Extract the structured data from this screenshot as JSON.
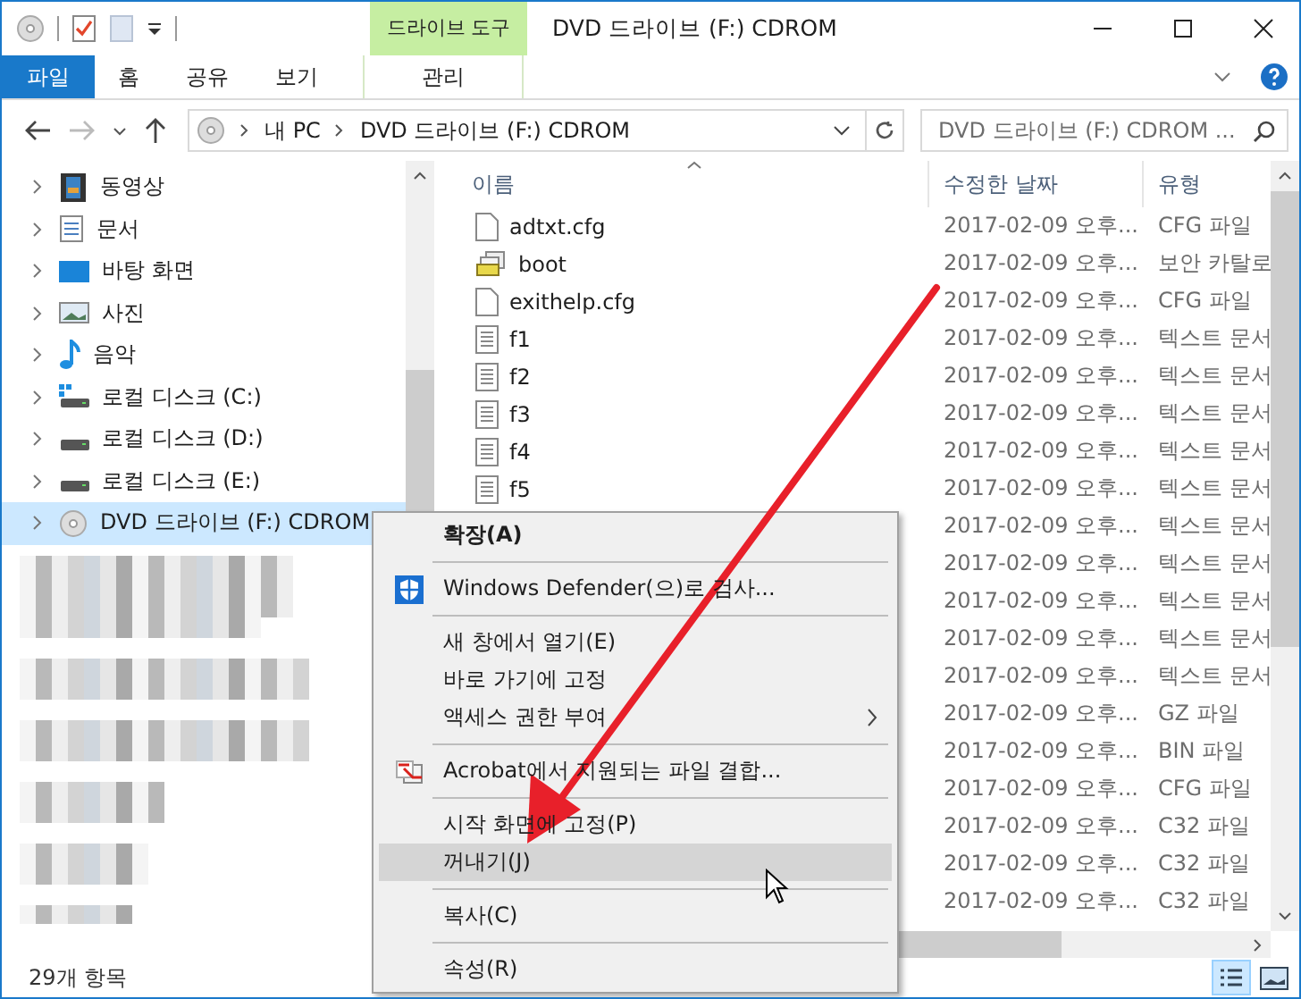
{
  "window": {
    "title": "DVD 드라이브 (F:) CDROM",
    "context_group": "드라이브 도구"
  },
  "ribbon_tabs": [
    {
      "label": "파일",
      "kind": "file",
      "selected": false
    },
    {
      "label": "홈",
      "kind": "tab",
      "selected": false
    },
    {
      "label": "공유",
      "kind": "tab",
      "selected": false
    },
    {
      "label": "보기",
      "kind": "tab",
      "selected": false
    },
    {
      "label": "관리",
      "kind": "contextual",
      "selected": false
    }
  ],
  "address_bar": {
    "path": [
      "내 PC",
      "DVD 드라이브 (F:) CDROM"
    ]
  },
  "search": {
    "placeholder": "DVD 드라이브 (F:) CDROM ..."
  },
  "nav_pane": {
    "items": [
      {
        "label": "동영상",
        "kind": "video",
        "selected": false
      },
      {
        "label": "문서",
        "kind": "document",
        "selected": false
      },
      {
        "label": "바탕 화면",
        "kind": "desktop",
        "selected": false
      },
      {
        "label": "사진",
        "kind": "photo",
        "selected": false
      },
      {
        "label": "음악",
        "kind": "music",
        "selected": false
      },
      {
        "label": "로컬 디스크 (C:)",
        "kind": "system",
        "selected": false
      },
      {
        "label": "로컬 디스크 (D:)",
        "kind": "drive",
        "selected": false
      },
      {
        "label": "로컬 디스크 (E:)",
        "kind": "drive",
        "selected": false
      },
      {
        "label": "DVD 드라이브 (F:) CDROM",
        "kind": "disc",
        "selected": true
      }
    ]
  },
  "file_list": {
    "columns": [
      "이름",
      "수정한 날짜",
      "유형"
    ],
    "rows": [
      {
        "name": "adtxt.cfg",
        "kind": "blank",
        "modified": "2017-02-09 오후...",
        "type": "CFG 파일"
      },
      {
        "name": "boot",
        "kind": "catalog",
        "modified": "2017-02-09 오후...",
        "type": "보안 카탈로"
      },
      {
        "name": "exithelp.cfg",
        "kind": "blank",
        "modified": "2017-02-09 오후...",
        "type": "CFG 파일"
      },
      {
        "name": "f1",
        "kind": "text",
        "modified": "2017-02-09 오후...",
        "type": "텍스트 문서"
      },
      {
        "name": "f2",
        "kind": "text",
        "modified": "2017-02-09 오후...",
        "type": "텍스트 문서"
      },
      {
        "name": "f3",
        "kind": "text",
        "modified": "2017-02-09 오후...",
        "type": "텍스트 문서"
      },
      {
        "name": "f4",
        "kind": "text",
        "modified": "2017-02-09 오후...",
        "type": "텍스트 문서"
      },
      {
        "name": "f5",
        "kind": "text",
        "modified": "2017-02-09 오후...",
        "type": "텍스트 문서"
      },
      {
        "modified": "2017-02-09 오후...",
        "type": "텍스트 문서"
      },
      {
        "modified": "2017-02-09 오후...",
        "type": "텍스트 문서"
      },
      {
        "modified": "2017-02-09 오후...",
        "type": "텍스트 문서"
      },
      {
        "modified": "2017-02-09 오후...",
        "type": "텍스트 문서"
      },
      {
        "modified": "2017-02-09 오후...",
        "type": "텍스트 문서"
      },
      {
        "modified": "2017-02-09 오후...",
        "type": "GZ 파일"
      },
      {
        "modified": "2017-02-09 오후...",
        "type": "BIN 파일"
      },
      {
        "modified": "2017-02-09 오후...",
        "type": "CFG 파일"
      },
      {
        "modified": "2017-02-09 오후...",
        "type": "C32 파일"
      },
      {
        "modified": "2017-02-09 오후...",
        "type": "C32 파일"
      },
      {
        "modified": "2017-02-09 오후...",
        "type": "C32 파일"
      }
    ]
  },
  "context_menu": {
    "items": [
      {
        "kind": "item",
        "label": "확장(A)",
        "bold": true,
        "submenu": false,
        "selected": false
      },
      {
        "kind": "separator"
      },
      {
        "kind": "defender",
        "label": "Windows Defender(으)로 검사...",
        "bold": false,
        "submenu": false,
        "selected": false
      },
      {
        "kind": "separator"
      },
      {
        "kind": "item",
        "label": "새 창에서 열기(E)",
        "bold": false,
        "submenu": false,
        "selected": false
      },
      {
        "kind": "item",
        "label": "바로 가기에 고정",
        "bold": false,
        "submenu": false,
        "selected": false
      },
      {
        "kind": "item",
        "label": "액세스 권한 부여",
        "bold": false,
        "submenu": true,
        "selected": false
      },
      {
        "kind": "separator"
      },
      {
        "kind": "acrobat",
        "label": "Acrobat에서 지원되는 파일 결합...",
        "bold": false,
        "submenu": false,
        "selected": false
      },
      {
        "kind": "separator"
      },
      {
        "kind": "item",
        "label": "시작 화면에 고정(P)",
        "bold": false,
        "submenu": false,
        "selected": false
      },
      {
        "kind": "item",
        "label": "꺼내기(J)",
        "bold": false,
        "submenu": false,
        "selected": true
      },
      {
        "kind": "separator"
      },
      {
        "kind": "item",
        "label": "복사(C)",
        "bold": false,
        "submenu": false,
        "selected": false
      },
      {
        "kind": "separator"
      },
      {
        "kind": "item",
        "label": "속성(R)",
        "bold": false,
        "submenu": false,
        "selected": false
      }
    ]
  },
  "status_bar": {
    "item_count": "29개 항목"
  },
  "view_buttons": [
    {
      "kind": "details",
      "selected": true
    },
    {
      "kind": "large-icons",
      "selected": false
    }
  ]
}
